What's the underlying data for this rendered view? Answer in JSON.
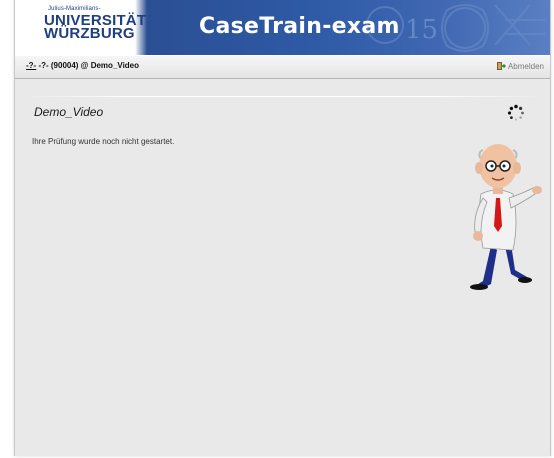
{
  "header": {
    "university_small": "Julius-Maximilians-",
    "university_line1": "UNIVERSITÄT",
    "university_line2": "WÜRZBURG",
    "app_title": "CaseTrain-exam",
    "deco_number": "15",
    "brand_color": "#2e5aa6"
  },
  "toolbar": {
    "exam_prefix": "-?-",
    "exam_info": " -?- (90004) @ Demo_Video",
    "logout_label": "Abmelden"
  },
  "main": {
    "title": "Demo_Video",
    "status": "Ihre Prüfung wurde noch nicht gestartet."
  },
  "icons": {
    "logout": "logout-icon",
    "spinner": "loading-spinner-icon",
    "mascot": "professor-mascot"
  }
}
